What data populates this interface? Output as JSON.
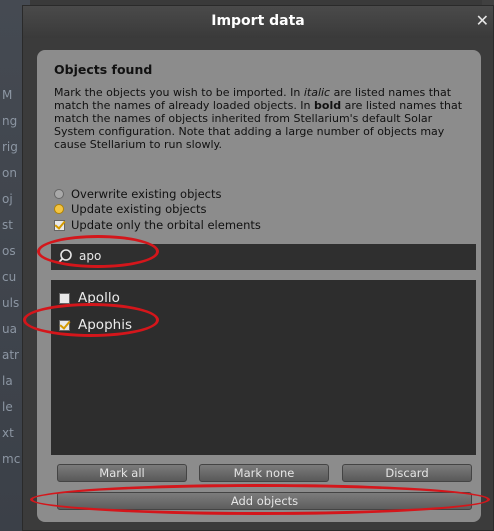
{
  "dialog": {
    "title": "Import data",
    "close_glyph": "✕"
  },
  "section": {
    "heading": "Objects found",
    "description_html": "Mark the objects you wish to be imported. In <i>italic</i> are listed names that match the names of already loaded objects. In <b>bold</b> are listed names that match the names of objects inherited from Stellarium's default Solar System configuration. Note that adding a large number of objects may cause Stellarium to run slowly."
  },
  "options": {
    "overwrite_label": "Overwrite existing objects",
    "overwrite_selected": false,
    "update_label": "Update existing objects",
    "update_selected": true,
    "orbital_label": "Update only the orbital elements",
    "orbital_checked": true
  },
  "search": {
    "value": "apo",
    "icon": "search-icon"
  },
  "objects": [
    {
      "name": "Apollo",
      "checked": false
    },
    {
      "name": "Apophis",
      "checked": true
    }
  ],
  "buttons": {
    "mark_all": "Mark all",
    "mark_none": "Mark none",
    "discard": "Discard",
    "add_objects": "Add objects"
  },
  "background_sidebar_letters": [
    "M",
    "ng",
    "rig",
    "on",
    "oj",
    "st",
    "os",
    "cu",
    "uls",
    "ua",
    "atr",
    "la",
    "le",
    "xt",
    "mc"
  ],
  "colors": {
    "accent": "#f4c542",
    "annotation": "#d4161b",
    "panel": "#8c8c8c",
    "list_bg": "#2d2d2d"
  }
}
